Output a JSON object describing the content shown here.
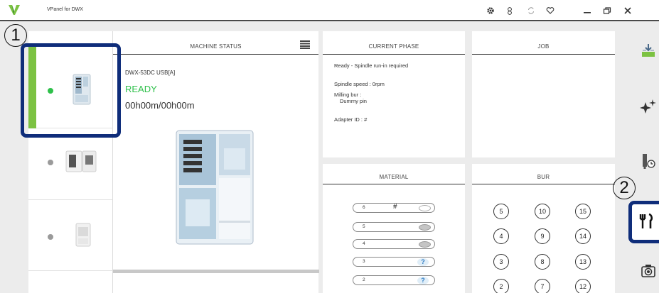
{
  "app": {
    "title": "VPanel for DWX",
    "logo_icon": "vpanel-logo-icon"
  },
  "titlebar_icons": [
    "settings-icon",
    "user-icon",
    "refresh-icon",
    "favorite-icon",
    "minimize-icon",
    "restore-icon",
    "close-icon"
  ],
  "callouts": {
    "one": "1",
    "two": "2"
  },
  "machines": [
    {
      "status_color": "#2ec04a",
      "selected": true
    },
    {
      "status_color": "#9a9a9a",
      "selected": false
    },
    {
      "status_color": "#9a9a9a",
      "selected": false
    }
  ],
  "machine_status": {
    "header": "MACHINE STATUS",
    "model": "DWX-53DC USB[A]",
    "state": "READY",
    "state_color": "#2ec04a",
    "time": "00h00m/00h00m"
  },
  "current_phase": {
    "header": "CURRENT PHASE",
    "status": "Ready - Spindle run-in required",
    "spindle_speed": "Spindle speed : 0rpm",
    "milling_bur_label": "Milling bur :",
    "milling_bur_value": "Dummy pin",
    "adapter_id": "Adapter ID : #"
  },
  "job": {
    "header": "JOB"
  },
  "material": {
    "header": "MATERIAL",
    "slots": [
      {
        "number": "6",
        "id": "#",
        "state": "empty-disc"
      },
      {
        "number": "5",
        "id": "",
        "state": "disc"
      },
      {
        "number": "4",
        "id": "",
        "state": "disc"
      },
      {
        "number": "3",
        "id": "",
        "state": "unknown"
      },
      {
        "number": "2",
        "id": "",
        "state": "unknown"
      }
    ],
    "unknown_mark": "?"
  },
  "bur": {
    "header": "BUR",
    "numbers": [
      "5",
      "10",
      "15",
      "4",
      "9",
      "14",
      "3",
      "8",
      "13",
      "2",
      "7",
      "12"
    ]
  },
  "rail_icons": [
    "milling-icon",
    "sparkle-icon",
    "tool-timer-icon",
    "tools-icon",
    "camera-icon"
  ]
}
